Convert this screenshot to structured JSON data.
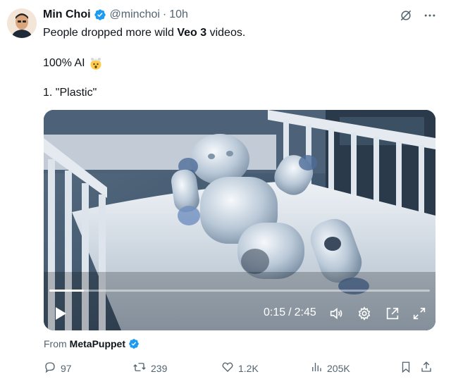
{
  "tweet": {
    "author_name": "Min Choi",
    "handle": "@minchoi",
    "separator": "·",
    "time": "10h",
    "text_line1_prefix": "People dropped more wild ",
    "text_line1_bold": "Veo 3",
    "text_line1_suffix": " videos.",
    "text_line2": "100% AI",
    "text_line3": "1. \"Plastic\""
  },
  "video": {
    "time_current": "0:15",
    "time_separator": "/",
    "time_total": "2:45",
    "progress_fraction": 0.091
  },
  "source": {
    "prefix": "From",
    "name": "MetaPuppet"
  },
  "actions": {
    "replies": "97",
    "retweets": "239",
    "likes": "1.2K",
    "views": "205K"
  },
  "colors": {
    "verified": "#1d9bf0",
    "secondary_text": "#536471",
    "primary_text": "#0f1419"
  },
  "icons": [
    "verified-badge-icon",
    "grok-icon",
    "more-icon",
    "exploding-head-emoji",
    "play-icon",
    "volume-icon",
    "settings-icon",
    "pip-icon",
    "fullscreen-icon",
    "reply-icon",
    "retweet-icon",
    "like-icon",
    "views-icon",
    "bookmark-icon",
    "share-icon"
  ]
}
